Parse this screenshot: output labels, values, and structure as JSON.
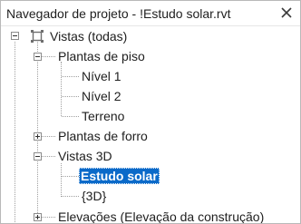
{
  "window": {
    "title": "Navegador de projeto - !Estudo solar.rvt",
    "close_icon": "close-icon"
  },
  "tree": {
    "root": {
      "label": "Vistas (todas)",
      "icon": "views-icon",
      "expanded": true,
      "children": {
        "floor_plans": {
          "label": "Plantas de piso",
          "expanded": true,
          "items": [
            "Nível 1",
            "Nível 2",
            "Terreno"
          ]
        },
        "ceiling_plans": {
          "label": "Plantas de forro",
          "expanded": false
        },
        "views_3d": {
          "label": "Vistas 3D",
          "expanded": true,
          "items": [
            "Estudo solar",
            "{3D}"
          ],
          "selected": "Estudo solar"
        },
        "elevations": {
          "label": "Elevações (Elevação da construção)",
          "expanded": false
        }
      }
    }
  },
  "colors": {
    "selection": "#0b6ac9",
    "connector": "#a0a0a0",
    "border": "#b9b9b9"
  }
}
